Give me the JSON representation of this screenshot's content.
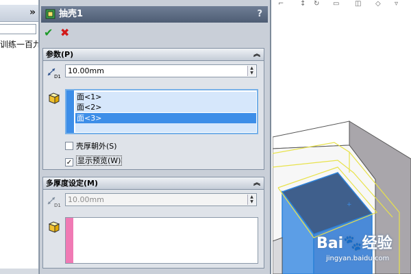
{
  "left_panel": {
    "expand_symbol": "»",
    "tree_text": "训练一百九"
  },
  "panel": {
    "title": "抽壳1",
    "help_symbol": "?",
    "ok_symbol": "✔",
    "cancel_symbol": "✖",
    "params": {
      "header": "参数(P)",
      "thickness": "10.00mm",
      "faces": [
        "面<1>",
        "面<2>",
        "面<3>"
      ],
      "selected_face_index": 2,
      "shell_outward_label": "壳厚朝外(S)",
      "shell_outward_checked": false,
      "show_preview_label": "显示预览(W)",
      "show_preview_checked": true
    },
    "multi": {
      "header": "多厚度设定(M)",
      "thickness": "10.00mm"
    }
  },
  "watermark": {
    "brand": "Bai",
    "brand_tail": "经验",
    "url": "jingyan.baidu.com"
  },
  "colors": {
    "title_bar": "#56657b",
    "selection_blue": "#3d8ee8",
    "face_strip_blue": "#3d8ee8",
    "face_strip_pink": "#f07ab4",
    "model_blue": "#3f5f8c"
  }
}
